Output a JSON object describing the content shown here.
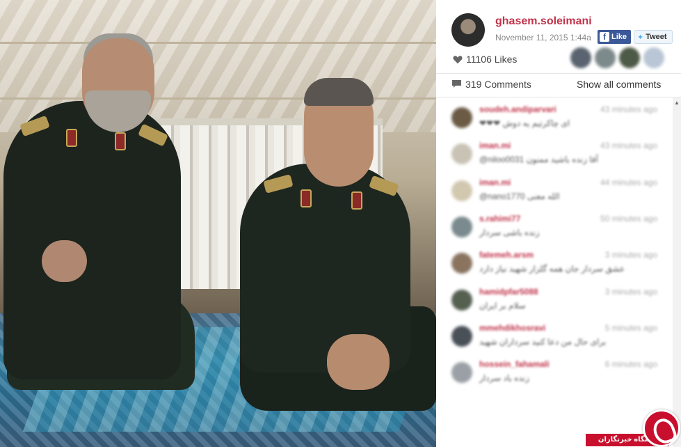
{
  "post": {
    "photo_alt": "",
    "username": "ghasem.soleimani",
    "date": "November 11, 2015 1:44a",
    "likes": "11106 Likes",
    "comments_count": "319 Comments",
    "show_all": "Show all comments"
  },
  "share": {
    "facebook_label": "Like",
    "twitter_label": "Tweet"
  },
  "comments": [
    {
      "user": "soudeh.andiparvari",
      "time": "43 minutes ago",
      "text": "❤❤❤ ای چاکرتیم یه دوش"
    },
    {
      "user": "iman.mi",
      "time": "43 minutes ago",
      "text": "@niloo0031 آقا زنده باشید ممنون"
    },
    {
      "user": "iman.mi",
      "time": "44 minutes ago",
      "text": "@nano1770 الله معنی"
    },
    {
      "user": "s.rahimi77",
      "time": "50 minutes ago",
      "text": "زنده باشی سردار"
    },
    {
      "user": "fatemeh.arsm",
      "time": "3 minutes ago",
      "text": "عشق سردار جان همه گلزار شهید نیاز دارد"
    },
    {
      "user": "hamidpfar5088",
      "time": "3 minutes ago",
      "text": "سلام بر ایران"
    },
    {
      "user": "mmehdikhosravi",
      "time": "5 minutes ago",
      "text": "برای حال من دعا کنید سرداران شهید"
    },
    {
      "user": "hossein_fahamali",
      "time": "6 minutes ago",
      "text": "زنده باد سردار"
    }
  ],
  "watermark": {
    "label": "باشگاه خبرنگاران"
  },
  "colors": {
    "username": "#c0334a",
    "facebook": "#3b5998",
    "twitter": "#55acee",
    "watermark": "#c8102e"
  },
  "icons": {
    "likes": "heart-icon",
    "comments": "comment-bubble-icon",
    "facebook": "facebook-icon",
    "twitter": "twitter-bird-icon"
  }
}
